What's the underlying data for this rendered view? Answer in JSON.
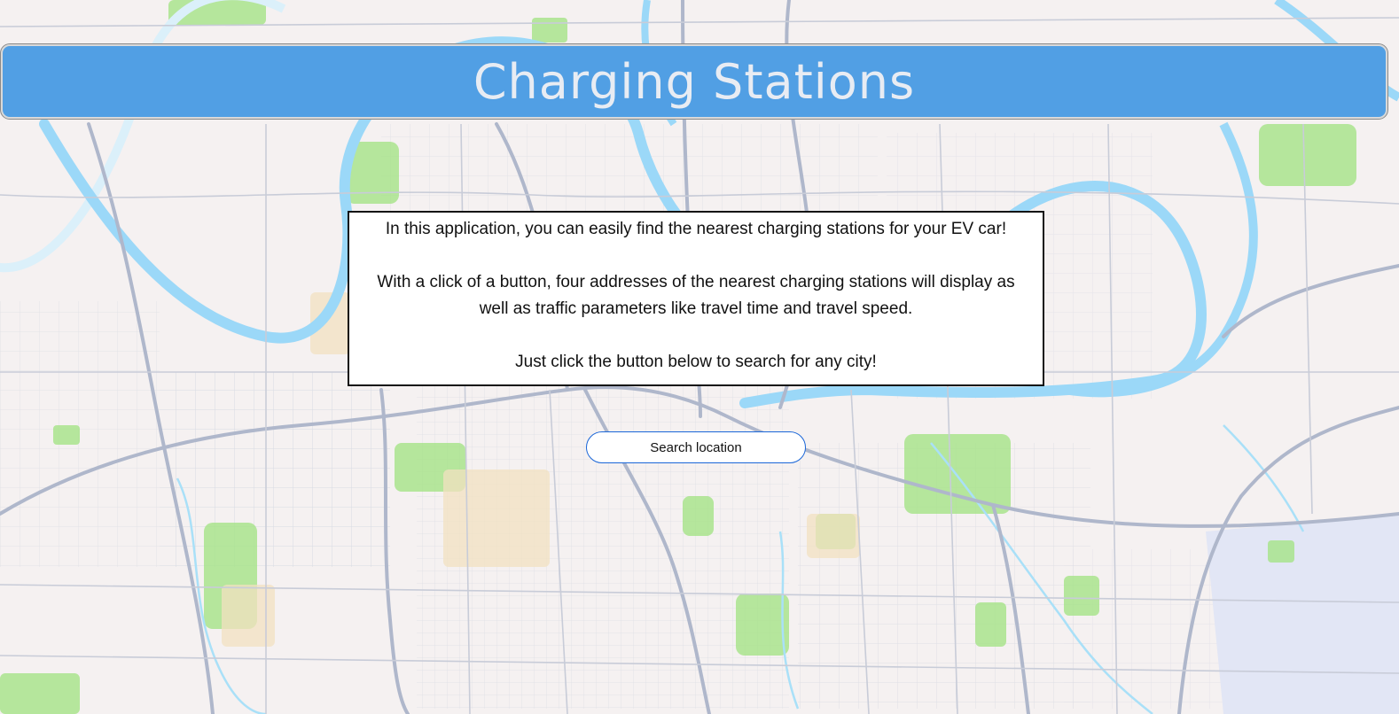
{
  "header": {
    "title": "Charging Stations"
  },
  "intro": {
    "line1": "In this application, you can easily find the nearest charging stations for your EV car!",
    "line2": "With a click of a button, four addresses of the nearest charging stations will display as well as traffic parameters like travel time and travel speed.",
    "line3": "Just click the button below to search for any city!"
  },
  "search_button": {
    "label": "Search location"
  },
  "colors": {
    "header_bg": "#519fe4",
    "header_text": "#e8ecf3",
    "map_land": "#f4efef",
    "map_water": "#8ed3f7",
    "map_park": "#9ee07e",
    "map_road": "#b6bccd",
    "button_border": "#1a66d8"
  }
}
